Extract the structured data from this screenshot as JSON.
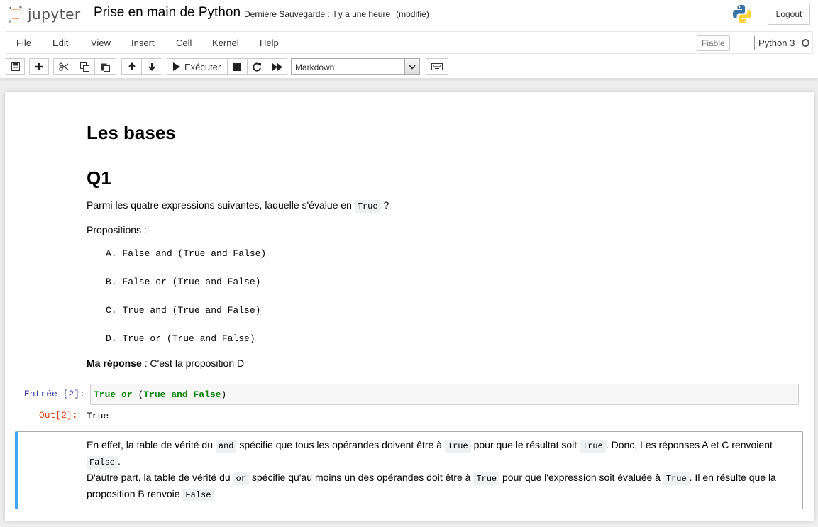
{
  "header": {
    "logo_text": "jupyter",
    "notebook_title": "Prise en main de Python",
    "save_status": "Dernière Sauvegarde : il y a une heure",
    "dirty_status": "(modifié)",
    "logout_label": "Logout"
  },
  "menubar": {
    "items": [
      "File",
      "Edit",
      "View",
      "Insert",
      "Cell",
      "Kernel",
      "Help"
    ],
    "trusted_label": "Fiable",
    "kernel_name": "Python 3"
  },
  "toolbar": {
    "run_label": "Exécuter",
    "cell_type": "Markdown",
    "icons": [
      "save-icon",
      "plus-icon",
      "cut-icon",
      "copy-icon",
      "paste-icon",
      "arrow-up-icon",
      "arrow-down-icon",
      "play-icon",
      "stop-icon",
      "restart-icon",
      "fast-forward-icon",
      "keyboard-icon"
    ]
  },
  "cells": {
    "h1": "Les bases",
    "h2": "Q1",
    "question_before": "Parmi les quatre expressions suivantes, laquelle s'évalue en",
    "question_code": "True",
    "question_after": "?",
    "propositions_label": "Propositions :",
    "propositions": [
      "A. False and (True and False)",
      "B. False or (True and False)",
      "C. True and (True and False)",
      "D. True or (True and False)"
    ],
    "answer_bold": "Ma réponse",
    "answer_rest": " : C'est la proposition D",
    "input_prompt": "Entrée [2]:",
    "input_code": {
      "t1": "True",
      "t2": " or ",
      "t3": "(",
      "t4": "True",
      "t5": " and ",
      "t6": "False",
      "t7": ")"
    },
    "output_prompt": "Out[2]:",
    "output_text": "True",
    "explanation": {
      "s1": "En effet, la table de vérité du",
      "c1": "and",
      "s2": "spécifie que tous les opérandes doivent être à",
      "c2": "True",
      "s3": "pour que le résultat soit",
      "c3": "True",
      "s4": ". Donc, Les réponses A et C renvoient",
      "c4": "False",
      "s5": ".",
      "s6": "D'autre part, la table de vérité du",
      "c5": "or",
      "s7": "spécifie qu'au moins un des opérandes doit être à",
      "c6": "True",
      "s8": "pour que l'expression soit évaluée à",
      "c7": "True",
      "s9": ". Il en résulte que la proposition B renvoie",
      "c8": "False"
    }
  },
  "colors": {
    "selected_border": "#42a5f5",
    "in_prompt": "#303f9f",
    "out_prompt": "#d84315",
    "keyword": "#008000"
  }
}
